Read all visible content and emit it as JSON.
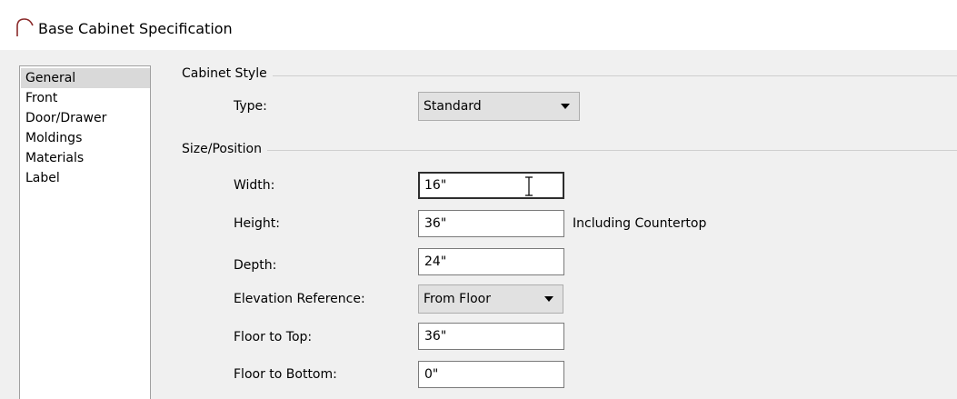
{
  "window": {
    "title": "Base Cabinet Specification"
  },
  "nav": {
    "items": [
      {
        "label": "General",
        "selected": true
      },
      {
        "label": "Front",
        "selected": false
      },
      {
        "label": "Door/Drawer",
        "selected": false
      },
      {
        "label": "Moldings",
        "selected": false
      },
      {
        "label": "Materials",
        "selected": false
      },
      {
        "label": "Label",
        "selected": false
      }
    ]
  },
  "cabinet_style": {
    "group_title": "Cabinet Style",
    "type_label": "Type:",
    "type_value": "Standard"
  },
  "size_position": {
    "group_title": "Size/Position",
    "width_label": "Width:",
    "width_value": "16\"",
    "height_label": "Height:",
    "height_value": "36\"",
    "height_note": "Including Countertop",
    "depth_label": "Depth:",
    "depth_value": "24\"",
    "elevation_label": "Elevation Reference:",
    "elevation_value": "From Floor",
    "floor_to_top_label": "Floor to Top:",
    "floor_to_top_value": "36\"",
    "floor_to_bottom_label": "Floor to Bottom:",
    "floor_to_bottom_value": "0\""
  }
}
